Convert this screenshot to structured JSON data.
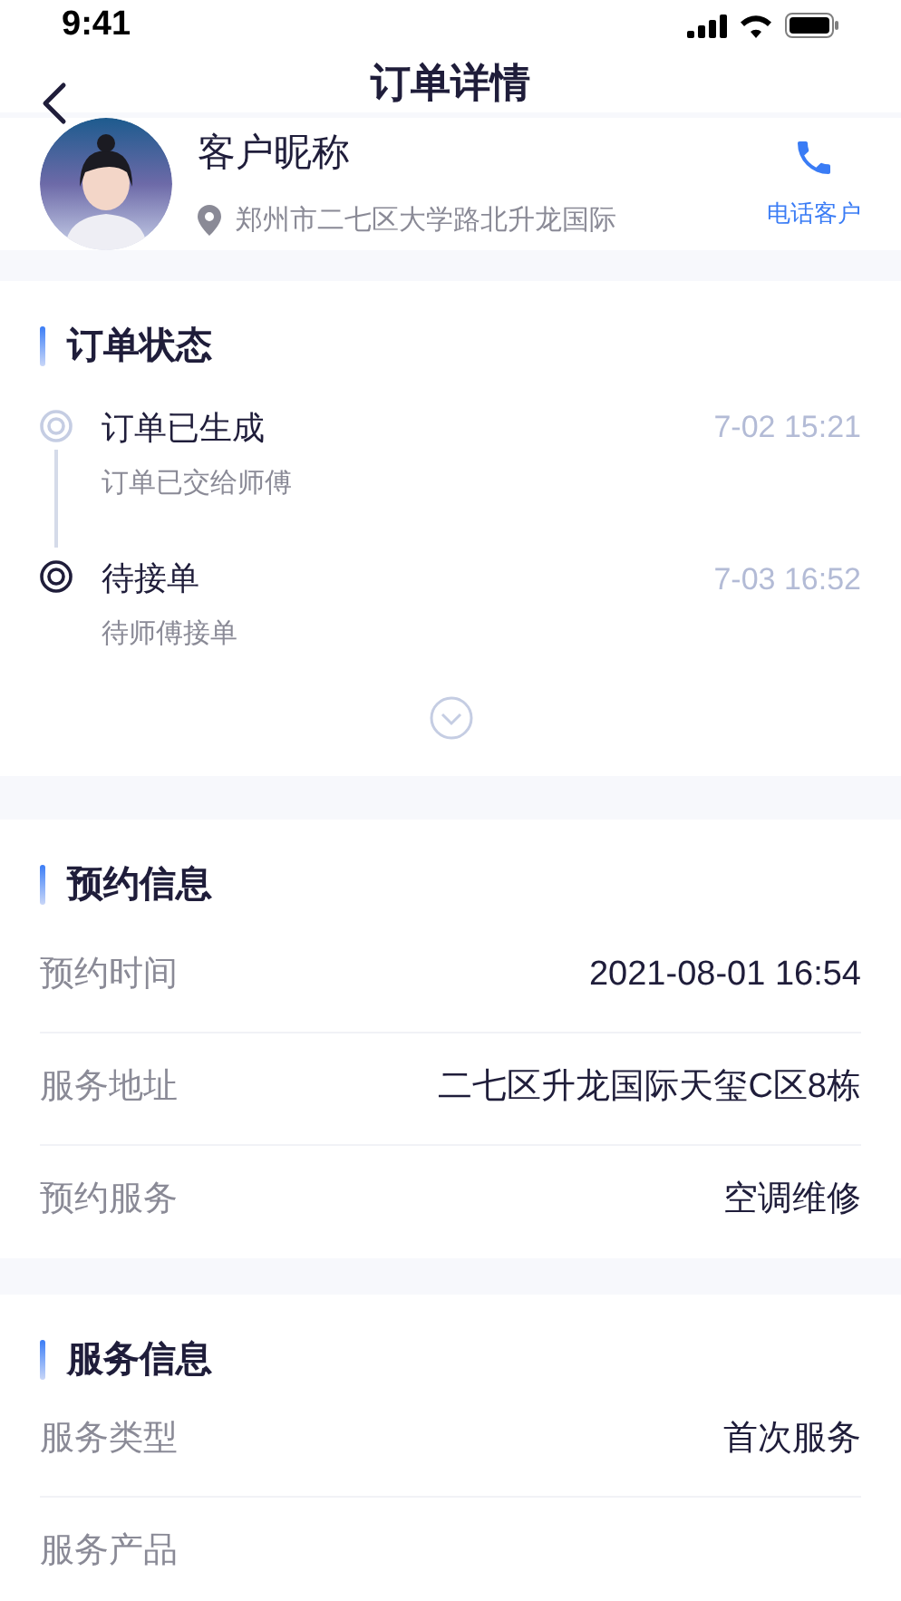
{
  "status_bar": {
    "time": "9:41"
  },
  "header": {
    "title": "订单详情"
  },
  "customer": {
    "name": "客户昵称",
    "address": "郑州市二七区大学路北升龙国际",
    "call_label": "电话客户"
  },
  "order_status": {
    "title": "订单状态",
    "steps": [
      {
        "title": "订单已生成",
        "subtitle": "订单已交给师傅",
        "time": "7-02  15:21",
        "current": false
      },
      {
        "title": "待接单",
        "subtitle": "待师傅接单",
        "time": "7-03  16:52",
        "current": true
      }
    ],
    "expanded": false
  },
  "reservation": {
    "title": "预约信息",
    "rows": [
      {
        "label": "预约时间",
        "value": "2021-08-01  16:54"
      },
      {
        "label": "服务地址",
        "value": "二七区升龙国际天玺C区8栋"
      },
      {
        "label": "预约服务",
        "value": "空调维修"
      }
    ]
  },
  "service": {
    "title": "服务信息",
    "rows": [
      {
        "label": "服务类型",
        "value": "首次服务"
      },
      {
        "label": "服务产品"
      }
    ]
  }
}
